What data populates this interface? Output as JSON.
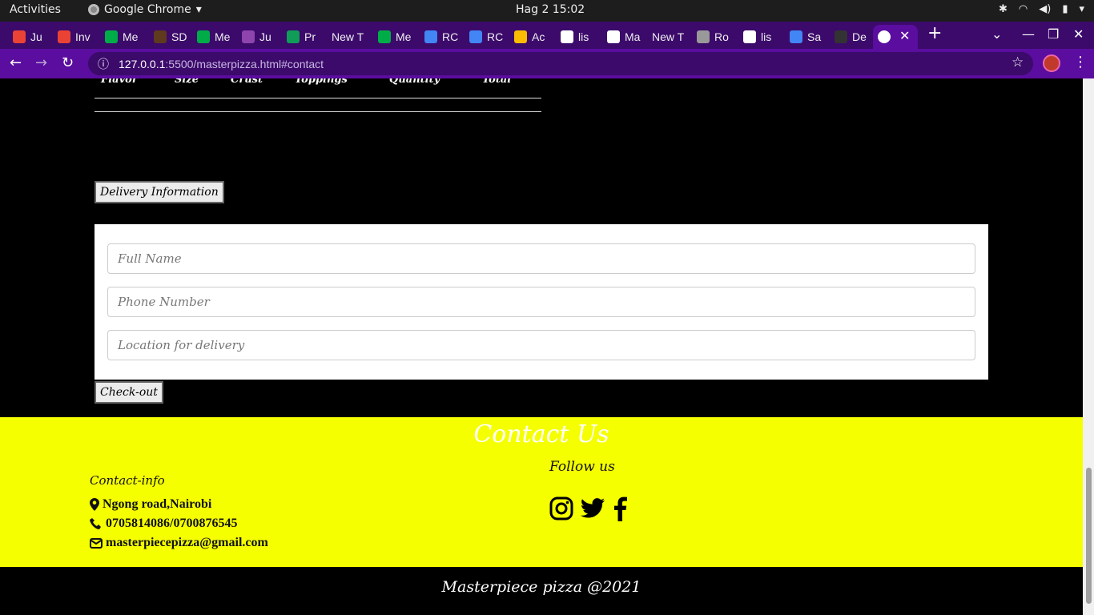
{
  "system": {
    "activities": "Activities",
    "app_name": "Google Chrome",
    "clock": "Hag 2  15:02"
  },
  "tabs": [
    {
      "label": "Ju",
      "color": "#ea4335"
    },
    {
      "label": "Inv",
      "color": "#ea4335"
    },
    {
      "label": "Me",
      "color": "#00ac47"
    },
    {
      "label": "SD",
      "color": "#5f3a1e"
    },
    {
      "label": "Me",
      "color": "#00ac47"
    },
    {
      "label": "Ju",
      "color": "#8e44ad"
    },
    {
      "label": "Pr",
      "color": "#0f9d58"
    },
    {
      "label": "New T",
      "color": ""
    },
    {
      "label": "Me",
      "color": "#00ac47"
    },
    {
      "label": "RC",
      "color": "#4285f4"
    },
    {
      "label": "RC",
      "color": "#4285f4"
    },
    {
      "label": "Ac",
      "color": "#fbbc04"
    },
    {
      "label": "lis",
      "color": "#ffffff"
    },
    {
      "label": "Ma",
      "color": "#ffffff"
    },
    {
      "label": "New T",
      "color": ""
    },
    {
      "label": "Ro",
      "color": "#999999"
    },
    {
      "label": "lis",
      "color": "#ffffff"
    },
    {
      "label": "Sa",
      "color": "#4285f4"
    },
    {
      "label": "De",
      "color": "#333333"
    }
  ],
  "address": {
    "host": "127.0.0.1",
    "path": ":5500/masterpizza.html#contact"
  },
  "order_table": {
    "headers": [
      "Flavor",
      "Size",
      "Crust",
      "Toppings",
      "Quantity",
      "Total"
    ]
  },
  "delivery_button": "Delivery Information",
  "form": {
    "name_placeholder": "Full Name",
    "phone_placeholder": "Phone Number",
    "location_placeholder": "Location for delivery"
  },
  "checkout_button": "Check-out",
  "contact": {
    "title": "Contact Us",
    "follow": "Follow us",
    "info_label": "Contact-info",
    "address": "Ngong road,Nairobi",
    "phone": "0705814086/0700876545",
    "email": "masterpiecepizza@gmail.com"
  },
  "footer": "Masterpiece pizza @2021",
  "colors": {
    "chrome_accent": "#5a0d9e",
    "contact_bg": "#f5ff00"
  }
}
